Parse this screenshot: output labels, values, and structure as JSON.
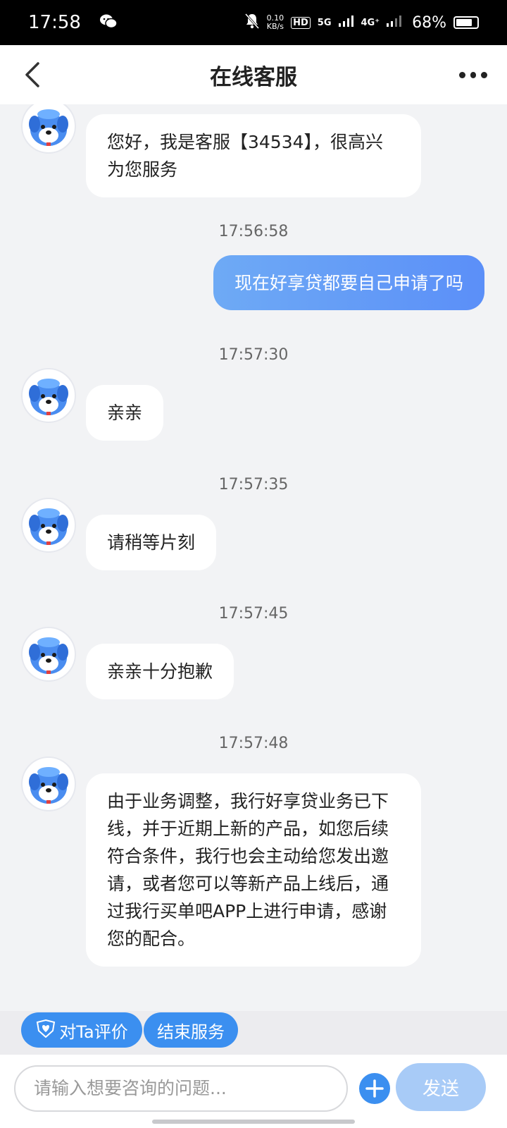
{
  "status_bar": {
    "time": "17:58",
    "speed_value": "0.10",
    "speed_unit": "KB/s",
    "hd": "HD",
    "net_5g": "5G",
    "net_4g": "4G⁺",
    "battery": "68%"
  },
  "header": {
    "title": "在线客服"
  },
  "messages": [
    {
      "side": "left",
      "text": "您好，我是客服【34534】，很高兴为您服务"
    },
    {
      "side": "right",
      "time": "17:56:58",
      "text": "现在好享贷都要自己申请了吗"
    },
    {
      "side": "left",
      "time": "17:57:30",
      "text": "亲亲"
    },
    {
      "side": "left",
      "time": "17:57:35",
      "text": "请稍等片刻"
    },
    {
      "side": "left",
      "time": "17:57:45",
      "text": "亲亲十分抱歉"
    },
    {
      "side": "left",
      "time": "17:57:48",
      "text": "由于业务调整，我行好享贷业务已下线，并于近期上新的产品，如您后续符合条件，我行也会主动给您发出邀请，或者您可以等新产品上线后，通过我行买单吧APP上进行申请，感谢您的配合。"
    }
  ],
  "actions": {
    "rate_label": "对Ta评价",
    "end_label": "结束服务"
  },
  "input": {
    "placeholder": "请输入想要咨询的问题...",
    "send_label": "发送"
  },
  "colors": {
    "accent": "#3b8ff0",
    "send_disabled": "#a8cbf7",
    "user_bubble_start": "#6eaaf5",
    "user_bubble_end": "#5b8ff8"
  }
}
